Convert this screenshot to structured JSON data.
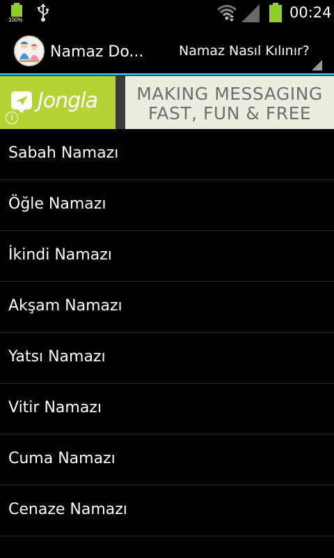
{
  "status_bar": {
    "battery_left_percent": "100%",
    "time": "00:24",
    "icons": [
      "battery-icon",
      "usb-icon",
      "wifi-icon",
      "signal-icon",
      "battery-icon"
    ]
  },
  "action_bar": {
    "title": "Namaz Do...",
    "spinner_selected": "Namaz Nasıl Kılınır?",
    "accent_color": "#33b5e5"
  },
  "ad": {
    "brand": "Jongla",
    "line1": "MAKING MESSAGING",
    "line2": "FAST, FUN & FREE",
    "brand_color": "#b5d334"
  },
  "prayers": [
    "Sabah Namazı",
    "Öğle Namazı",
    "İkindi Namazı",
    "Akşam Namazı",
    "Yatsı Namazı",
    "Vitir Namazı",
    "Cuma Namazı",
    "Cenaze Namazı"
  ]
}
